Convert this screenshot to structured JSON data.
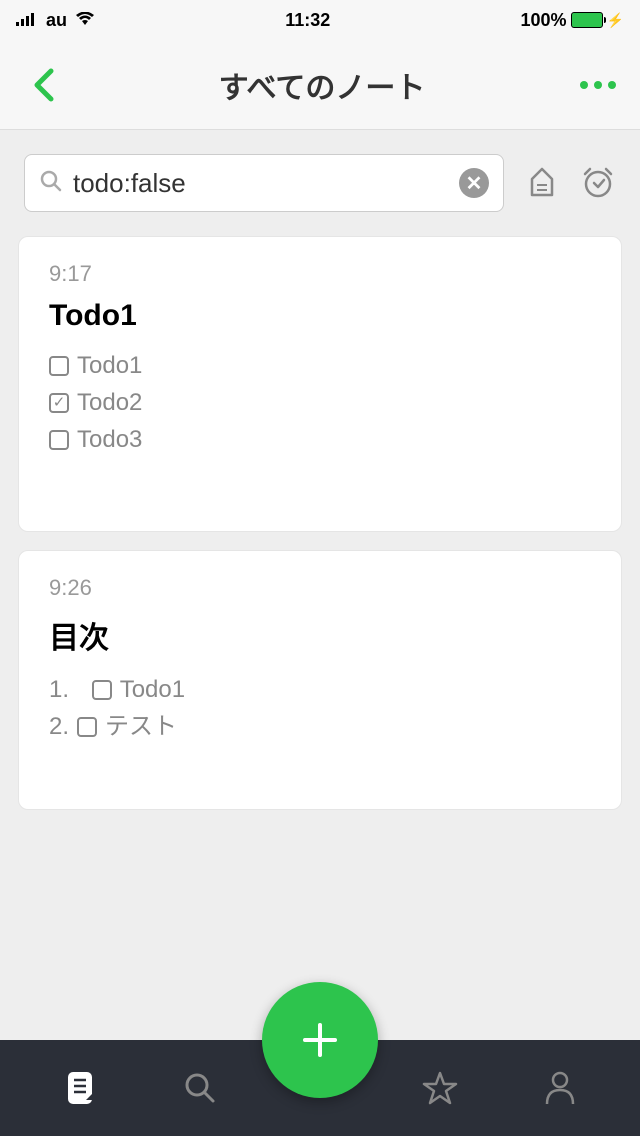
{
  "statusBar": {
    "carrier": "au",
    "time": "11:32",
    "battery": "100%"
  },
  "header": {
    "title": "すべてのノート"
  },
  "search": {
    "value": "todo:false"
  },
  "notes": [
    {
      "time": "9:17",
      "title": "Todo1",
      "items": [
        {
          "text": "Todo1",
          "checked": false
        },
        {
          "text": "Todo2",
          "checked": true
        },
        {
          "text": "Todo3",
          "checked": false
        }
      ]
    },
    {
      "time": "9:26",
      "title": "目次",
      "numberedItems": [
        {
          "num": "1.",
          "text": "Todo1"
        },
        {
          "num": "2.",
          "text": "テスト"
        }
      ]
    }
  ]
}
